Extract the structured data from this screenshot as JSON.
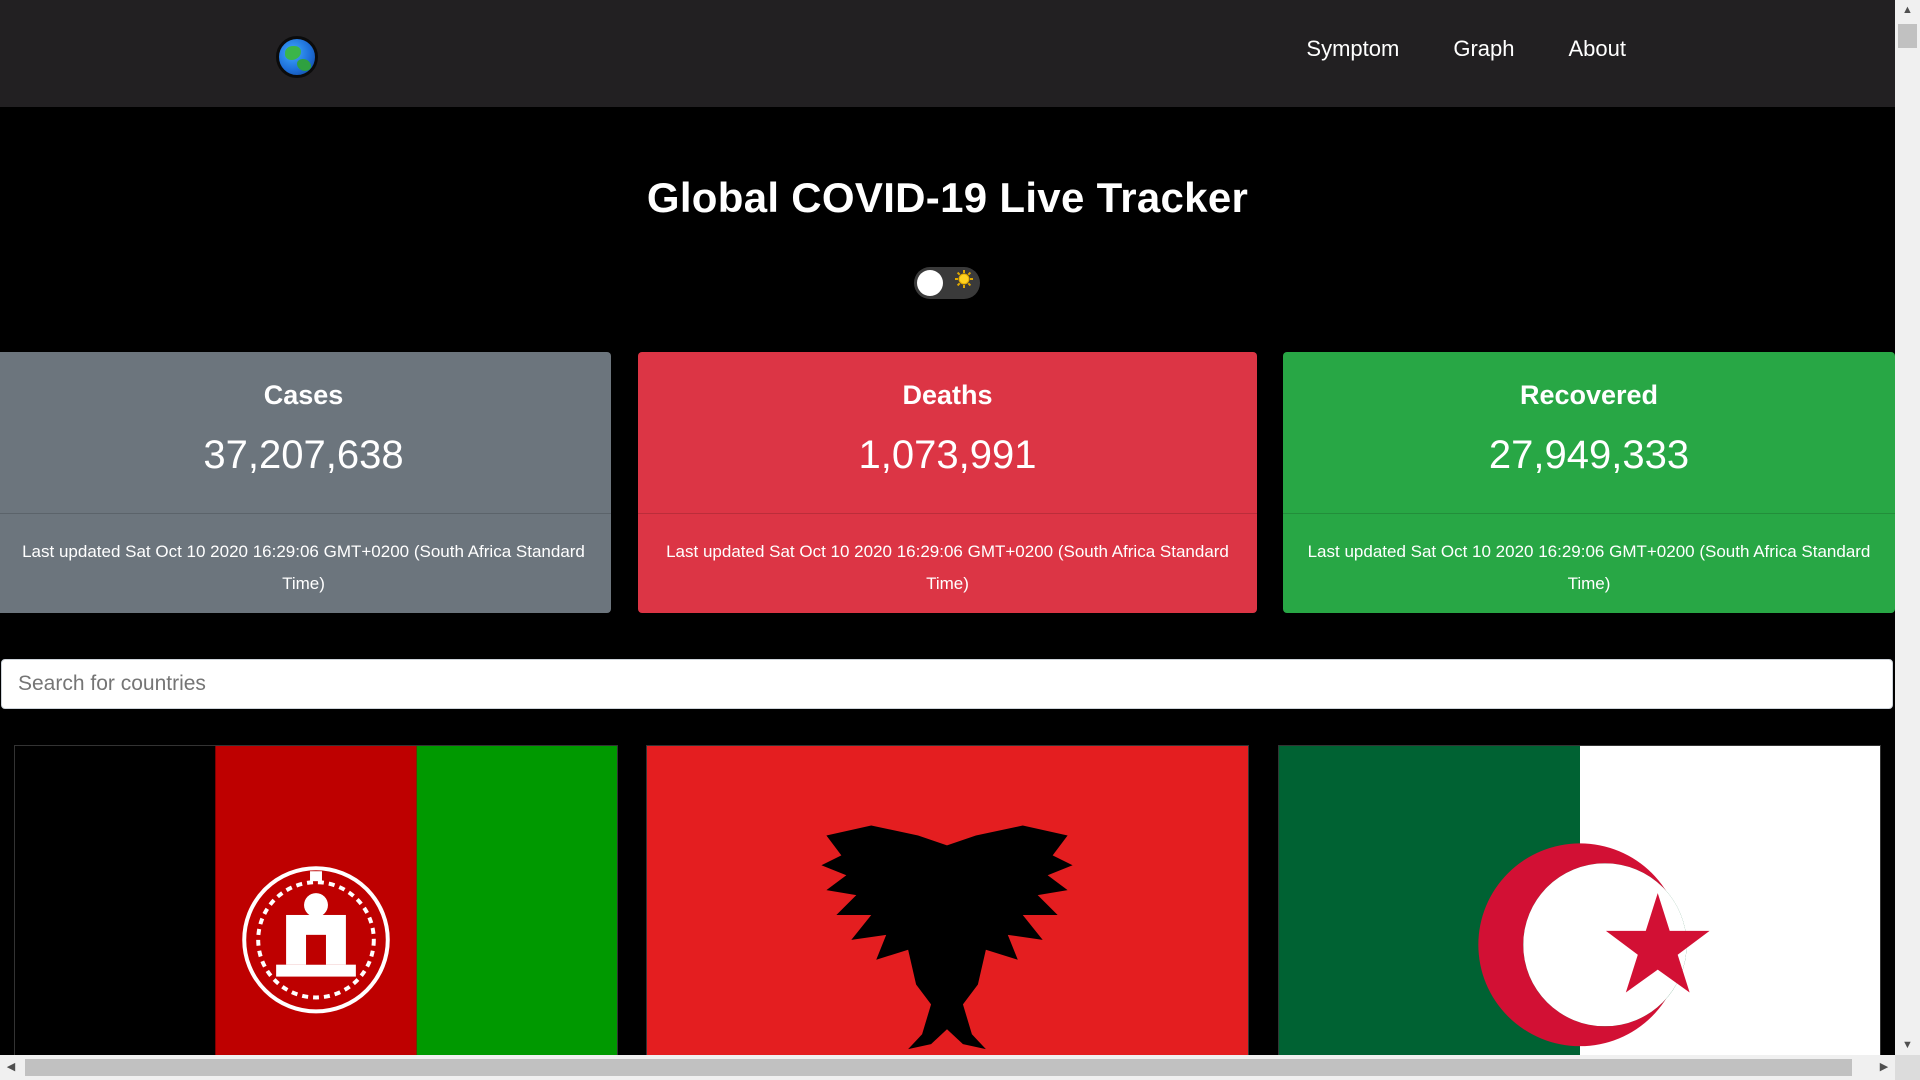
{
  "navbar": {
    "logo_icon": "globe-icon",
    "links": [
      {
        "label": "Symptom"
      },
      {
        "label": "Graph"
      },
      {
        "label": "About"
      }
    ]
  },
  "hero": {
    "title": "Global COVID-19 Live Tracker",
    "theme_toggle": {
      "state": "off",
      "icon": "sun-icon"
    }
  },
  "stats": {
    "cases": {
      "label": "Cases",
      "value": "37,207,638",
      "updated": "Last updated Sat Oct 10 2020 16:29:06 GMT+0200 (South Africa Standard Time)",
      "color": "#6c757d"
    },
    "deaths": {
      "label": "Deaths",
      "value": "1,073,991",
      "updated": "Last updated Sat Oct 10 2020 16:29:06 GMT+0200 (South Africa Standard Time)",
      "color": "#dc3545"
    },
    "recovered": {
      "label": "Recovered",
      "value": "27,949,333",
      "updated": "Last updated Sat Oct 10 2020 16:29:06 GMT+0200 (South Africa Standard Time)",
      "color": "#28a745"
    }
  },
  "search": {
    "placeholder": "Search for countries",
    "value": ""
  },
  "flags": [
    {
      "icon": "afghanistan-flag"
    },
    {
      "icon": "albania-flag"
    },
    {
      "icon": "algeria-flag"
    }
  ],
  "colors": {
    "navbar_bg": "#222022",
    "page_bg": "#000000"
  }
}
